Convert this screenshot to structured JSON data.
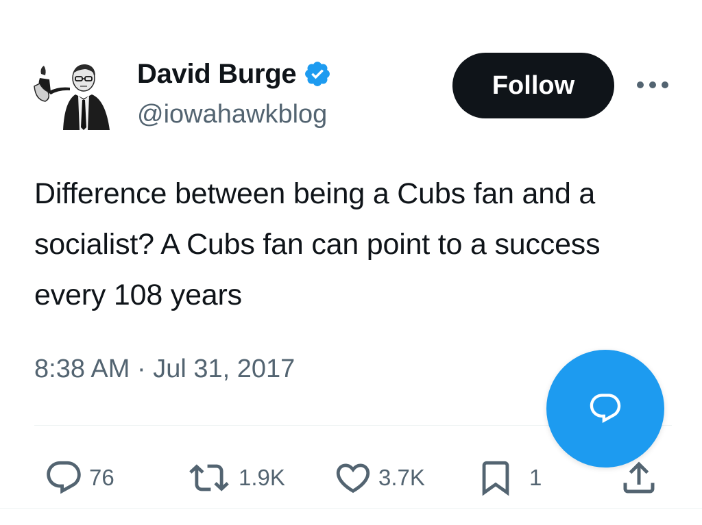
{
  "author": {
    "name": "David Burge",
    "handle": "@iowahawkblog",
    "verified": true
  },
  "header": {
    "follow_label": "Follow",
    "more_icon": "more-horizontal-icon"
  },
  "tweet": {
    "text": "Difference between being a Cubs fan and a socialist? A Cubs fan can point to a success every 108 years",
    "timestamp": "8:38 AM · Jul 31, 2017"
  },
  "actions": {
    "replies": {
      "icon": "reply-icon",
      "count": "76"
    },
    "retweets": {
      "icon": "retweet-icon",
      "count": "1.9K"
    },
    "likes": {
      "icon": "heart-icon",
      "count": "3.7K"
    },
    "bookmarks": {
      "icon": "bookmark-icon",
      "count": "1"
    },
    "share": {
      "icon": "share-icon"
    }
  },
  "fab": {
    "icon": "compose-reply-icon"
  },
  "colors": {
    "accent": "#1d9bf0",
    "text": "#0f1419",
    "secondary_text": "#536471",
    "button_dark": "#0f1419",
    "divider": "#eff3f4"
  }
}
